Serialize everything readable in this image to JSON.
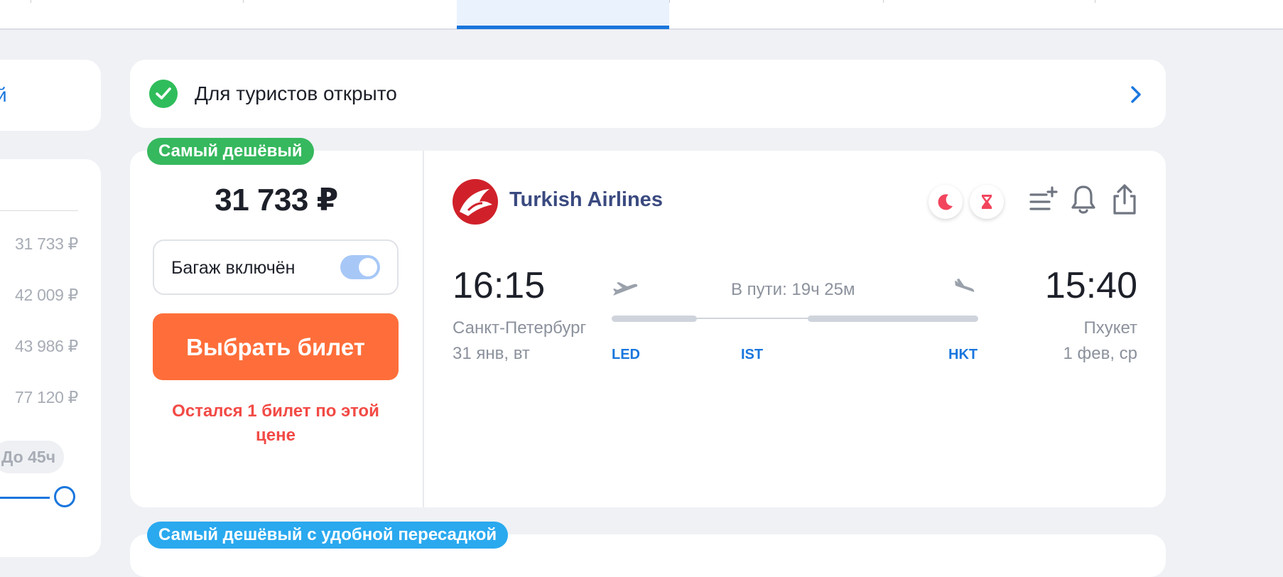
{
  "sidebar": {
    "card1_fragment": "й",
    "prices": [
      "31 733 ₽",
      "42 009 ₽",
      "43 986 ₽",
      "77 120 ₽"
    ],
    "duration_chip": "До 45ч"
  },
  "banner": {
    "text": "Для туристов открыто"
  },
  "ticket": {
    "badge": "Самый дешёвый",
    "price": "31 733 ₽",
    "baggage_label": "Багаж включён",
    "baggage_included": true,
    "buy_label": "Выбрать билет",
    "warning": "Остался 1 билет по этой цене",
    "airline": "Turkish Airlines",
    "departure": {
      "time": "16:15",
      "city": "Санкт-Петербург",
      "date": "31 янв, вт",
      "code": "LED"
    },
    "arrival": {
      "time": "15:40",
      "city": "Пхукет",
      "date": "1 фев, ср",
      "code": "HKT"
    },
    "transfer_code": "IST",
    "duration": "В пути: 19ч 25м"
  },
  "next_ticket": {
    "badge": "Самый дешёвый с удобной пересадкой"
  },
  "colors": {
    "accent": "#1976dd",
    "buy_button": "#ff6e3a",
    "badge_green": "#36b85e",
    "badge_blue": "#2aa9ef",
    "warning": "#f24a45"
  },
  "icons": [
    "check-circle-icon",
    "chevron-right-icon",
    "turkish-airlines-logo",
    "moon-icon",
    "hourglass-icon",
    "add-to-list-icon",
    "bell-icon",
    "share-icon",
    "plane-takeoff-icon",
    "plane-landing-icon"
  ]
}
